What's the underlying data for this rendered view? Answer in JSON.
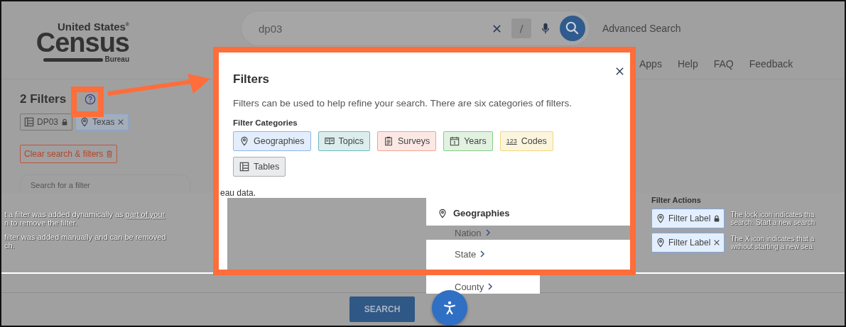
{
  "header": {
    "logo": {
      "line_1": "United States",
      "mark": "®",
      "line_2": "Census",
      "line_3": "Bureau"
    },
    "search": {
      "value": "dp03",
      "shortcut_key": "/"
    },
    "advanced_search": "Advanced Search",
    "nav": [
      "Apps",
      "Help",
      "FAQ",
      "Feedback"
    ]
  },
  "sidebar": {
    "filter_count": "2 Filters",
    "chips": [
      {
        "kind": "table",
        "label": "DP03",
        "locked": true
      },
      {
        "kind": "geography",
        "label": "Texas",
        "locked": false
      }
    ],
    "clear_button": "Clear search & filters",
    "search_placeholder": "Search for a filter"
  },
  "modal": {
    "title": "Filters",
    "description": "Filters can be used to help refine your search. There are six categories of filters.",
    "categories_heading": "Filter Categories",
    "categories": [
      {
        "kind": "geography",
        "label": "Geographies",
        "color": "#8fb6ee"
      },
      {
        "kind": "topics",
        "label": "Topics",
        "color": "#6fb8b8"
      },
      {
        "kind": "surveys",
        "label": "Surveys",
        "color": "#f0a393"
      },
      {
        "kind": "years",
        "label": "Years",
        "color": "#86cc86"
      },
      {
        "kind": "codes",
        "label": "Codes",
        "glyph": "123",
        "color": "#f2d77a"
      },
      {
        "kind": "table",
        "label": "Tables",
        "color": "#a9adb2"
      }
    ],
    "fragment": "eau data.",
    "geo_heading": "Geographies",
    "geo_items": [
      {
        "label": "Nation",
        "highlighted": true
      },
      {
        "label": "State",
        "highlighted": false
      }
    ]
  },
  "county_item": "County",
  "actions_dialog": {
    "left_paragraphs": [
      {
        "text": "t a filter was added dynamically as ",
        "link": "part of your",
        "line_2": "n to remove the filter."
      },
      {
        "text": "filter was added manually and can be removed",
        "line_2": "ch."
      }
    ],
    "heading": "Filter Actions",
    "examples": [
      {
        "label": "Filter Label",
        "locked": true,
        "line_1": "The lock icon indicates tha",
        "line_2": "search. Start a new search"
      },
      {
        "label": "Filter Label",
        "locked": false,
        "line_1": "The X icon indicates that a",
        "line_2": "without starting a new sea"
      }
    ]
  },
  "search_button": "SEARCH"
}
